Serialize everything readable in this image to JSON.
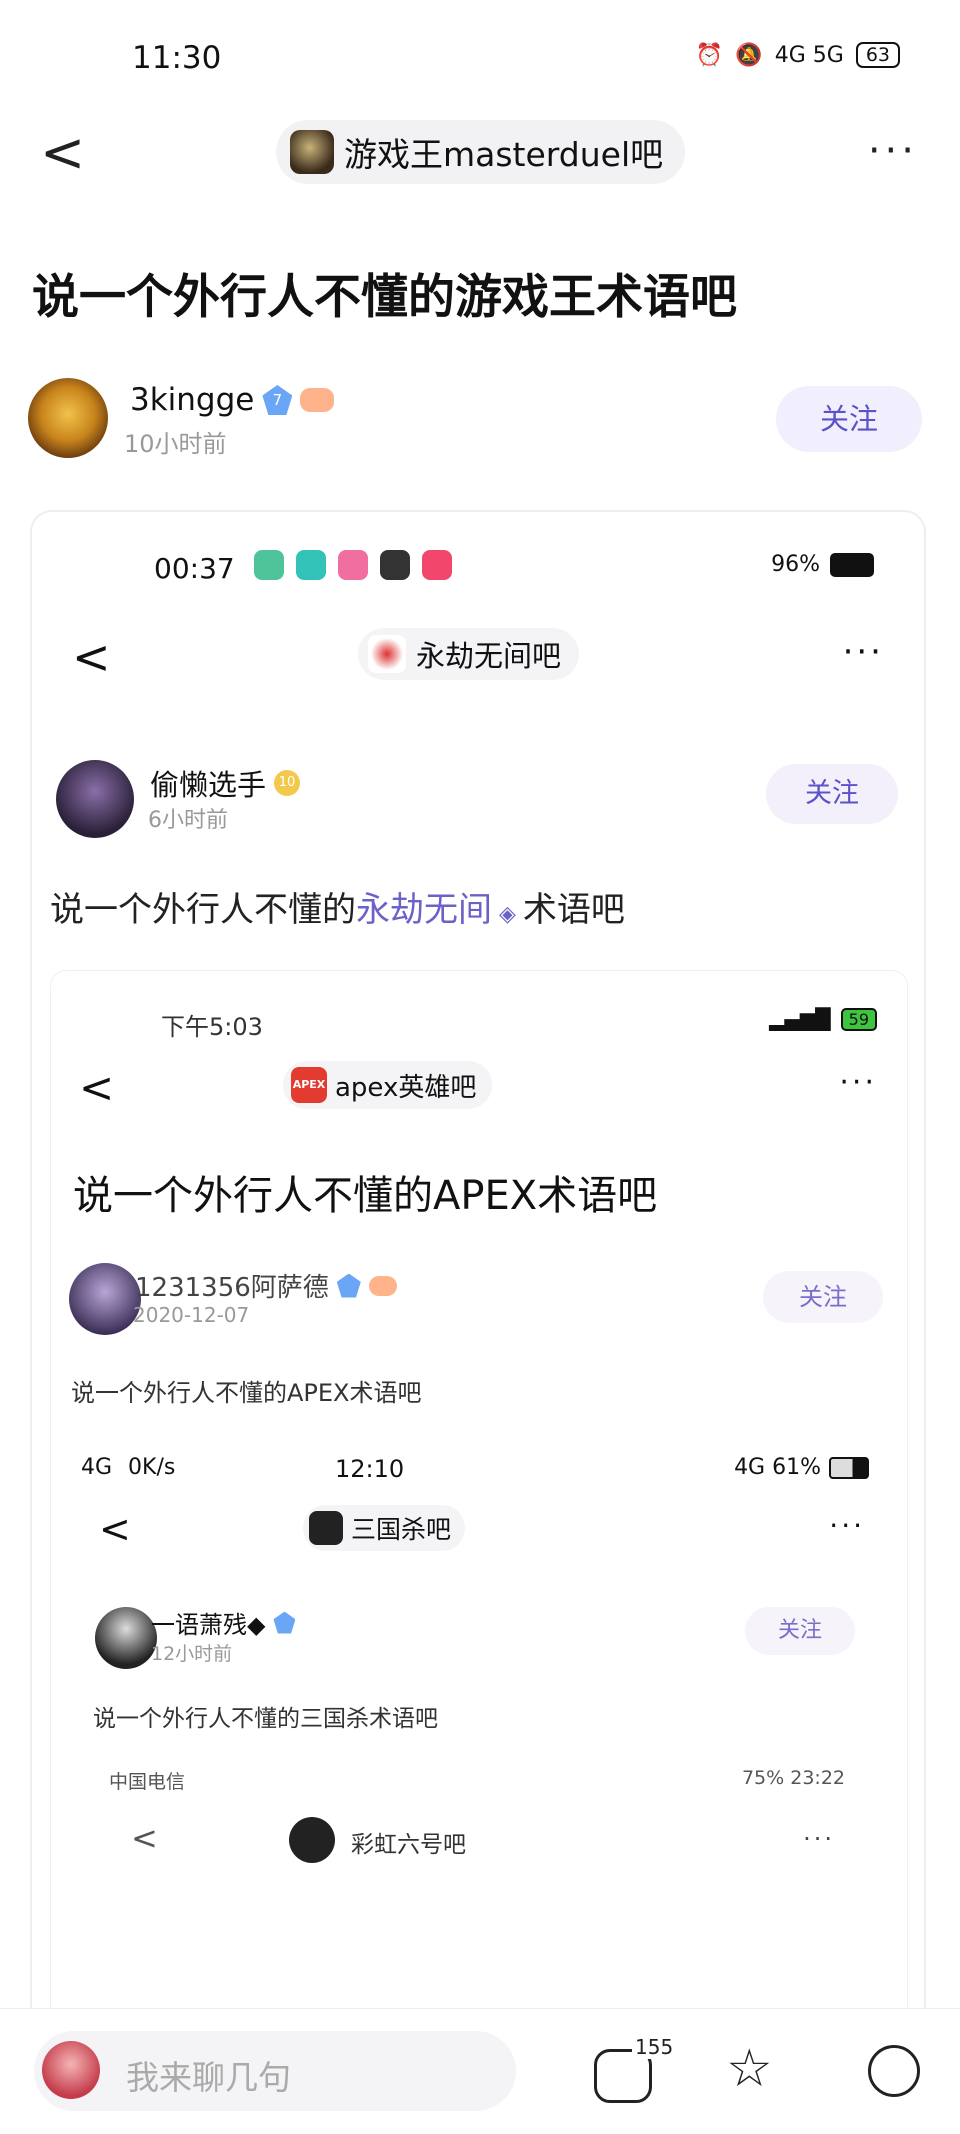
{
  "status": {
    "time": "11:30",
    "net": "4G 5G",
    "battery": "63"
  },
  "nav": {
    "back": "<",
    "forum": "游戏王masterduel吧",
    "more": "···"
  },
  "post": {
    "title": "说一个外行人不懂的游戏王术语吧",
    "author": "3kingge",
    "level": "7",
    "time": "10小时前",
    "follow": "关注"
  },
  "embed1": {
    "status_time": "00:37",
    "status_right": "96%",
    "forum": "永劫无间吧",
    "author": "偷懒选手",
    "level": "10",
    "time": "6小时前",
    "follow": "关注",
    "text_prefix": "说一个外行人不懂的",
    "text_link": "永劫无间",
    "text_suffix": "术语吧"
  },
  "embed2": {
    "status_time": "下午5:03",
    "battery": "59",
    "forum": "apex英雄吧",
    "logo": "APEX",
    "title": "说一个外行人不懂的APEX术语吧",
    "author": "1231356阿萨德",
    "date": "2020-12-07",
    "follow": "关注",
    "text": "说一个外行人不懂的APEX术语吧"
  },
  "embed3": {
    "status_left": "4G",
    "speed": "0K/s",
    "status_time": "12:10",
    "status_right": "4G 61%",
    "forum": "三国杀吧",
    "author": "一语萧残◆",
    "time": "12小时前",
    "follow": "关注",
    "text": "说一个外行人不懂的三国杀术语吧"
  },
  "embed4": {
    "carrier": "中国电信",
    "status_right": "75%  23:22",
    "forum": "彩虹六号吧"
  },
  "bottom": {
    "placeholder": "我来聊几句",
    "comment_count": "155"
  }
}
